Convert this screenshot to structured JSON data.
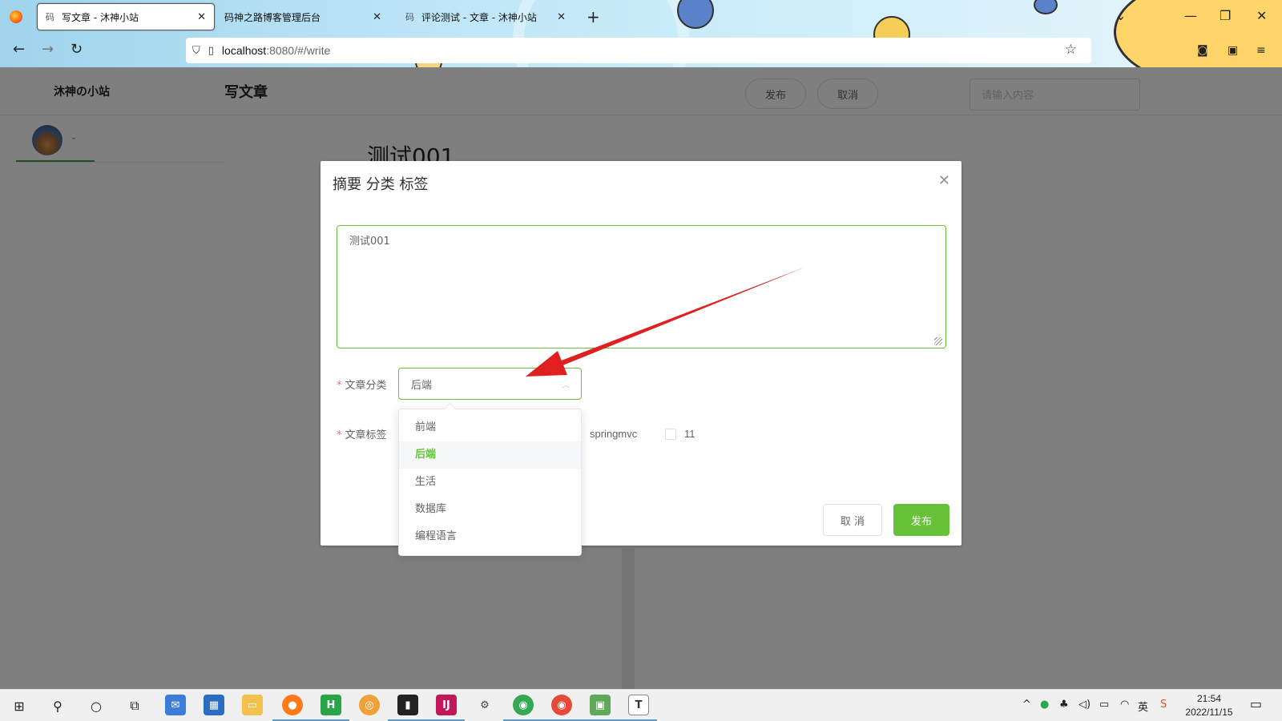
{
  "browser": {
    "tabs": [
      {
        "favicon": "码",
        "title": "写文章 - 沐神小站",
        "active": true
      },
      {
        "favicon": "",
        "title": "码神之路博客管理后台",
        "active": false
      },
      {
        "favicon": "码",
        "title": "评论测试 - 文章 - 沐神小站",
        "active": false
      }
    ],
    "url_host": "localhost",
    "url_rest": ":8080/#/write"
  },
  "site": {
    "name": "沐神の小站",
    "page_title": "写文章",
    "publish_label": "发布",
    "cancel_label": "取消",
    "search_placeholder": "请输入内容"
  },
  "article": {
    "title": "测试001"
  },
  "dialog": {
    "title": "摘要 分类 标签",
    "summary_value": "测试001",
    "category_label": "文章分类",
    "tags_label": "文章标签",
    "category_selected": "后端",
    "category_options": [
      "前端",
      "后端",
      "生活",
      "数据库",
      "编程语言"
    ],
    "tag_options": [
      "springmvc",
      "11"
    ],
    "cancel_label": "取 消",
    "publish_label": "发布"
  },
  "taskbar": {
    "time": "21:54",
    "date": "2022/11/15",
    "apps": [
      "mail",
      "store",
      "file-explorer",
      "firefox",
      "hbuilder",
      "edge-beta",
      "terminal",
      "intellij",
      "settings",
      "chrome",
      "browser-red",
      "wechat-dev",
      "typora"
    ]
  },
  "colors": {
    "accent_green": "#67c23a",
    "required_red": "#f56c6c",
    "annotation_arrow": "#e02020"
  }
}
